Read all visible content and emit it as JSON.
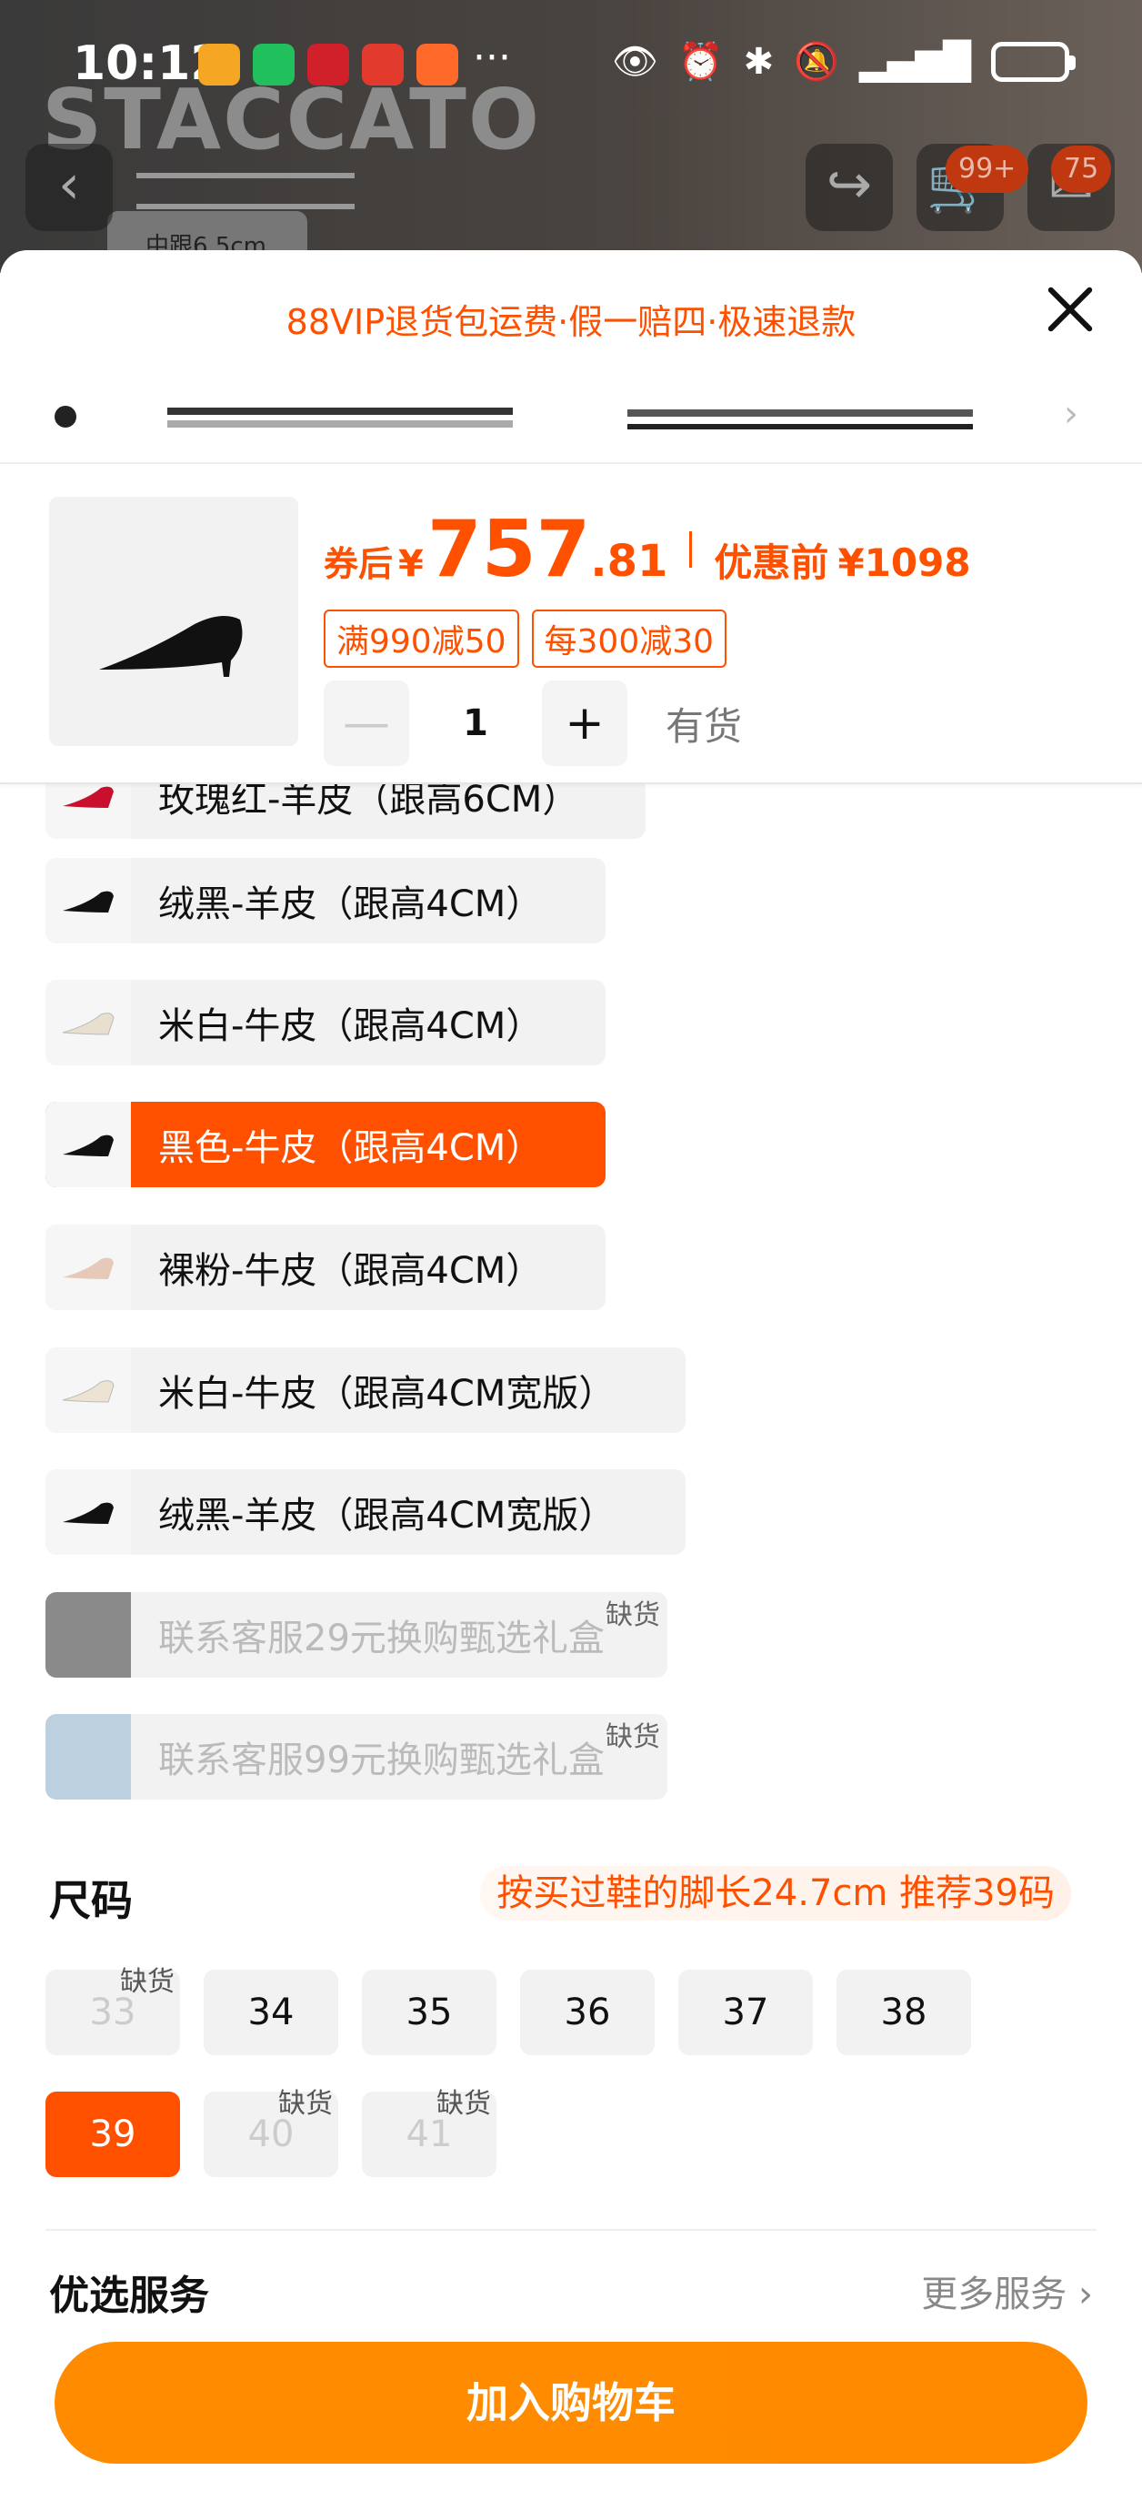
{
  "status_bar": {
    "time": "10:12",
    "more": "···"
  },
  "background": {
    "brand": "STACCATO",
    "chip": "中跟6.5cm",
    "badge_cart": "99+",
    "badge_msg": "75"
  },
  "sheet": {
    "promo": "88VIP退货包运费·假一赔四·极速退款"
  },
  "product": {
    "price_label": "券后",
    "currency": "¥",
    "price_int": "757",
    "price_dec": ".81",
    "orig_label": "优惠前",
    "orig_price": "¥1098",
    "coupons": [
      "满990减50",
      "每300减30"
    ],
    "qty_minus": "—",
    "qty_value": "1",
    "qty_plus": "+",
    "stock": "有货"
  },
  "colors": [
    {
      "label": "玫瑰红-羊皮（跟高6CM）",
      "state": "normal"
    },
    {
      "label": "绒黑-羊皮（跟高4CM）",
      "state": "normal"
    },
    {
      "label": "米白-牛皮（跟高4CM）",
      "state": "normal"
    },
    {
      "label": "黑色-牛皮（跟高4CM）",
      "state": "selected"
    },
    {
      "label": "裸粉-牛皮（跟高4CM）",
      "state": "normal"
    },
    {
      "label": "米白-牛皮（跟高4CM宽版）",
      "state": "normal"
    },
    {
      "label": "绒黑-羊皮（跟高4CM宽版）",
      "state": "normal"
    },
    {
      "label": "联系客服29元换购甄选礼盒",
      "state": "out_of_stock",
      "tag": "缺货"
    },
    {
      "label": "联系客服99元换购甄选礼盒",
      "state": "out_of_stock",
      "tag": "缺货"
    }
  ],
  "size": {
    "title": "尺码",
    "hint": "按买过鞋的脚长24.7cm 推荐39码",
    "oos_tag": "缺货",
    "options": [
      "33",
      "34",
      "35",
      "36",
      "37",
      "38",
      "39",
      "40",
      "41"
    ]
  },
  "service": {
    "title": "优选服务",
    "more": "更多服务 ›"
  },
  "cta": {
    "label": "加入购物车"
  },
  "colors_theme": {
    "accent": "#ff5000",
    "cta": "#ff8c00"
  }
}
